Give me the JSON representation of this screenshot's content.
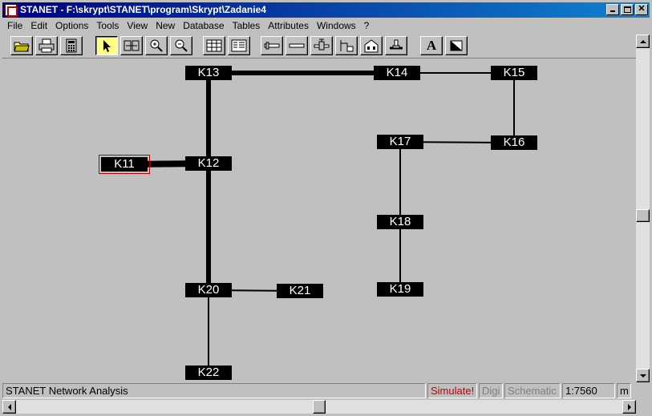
{
  "window": {
    "title": "STANET - F:\\skrypt\\STANET\\program\\Skrypt\\Zadanie4",
    "controls": [
      "minimize",
      "maximize",
      "close"
    ]
  },
  "menu": [
    "File",
    "Edit",
    "Options",
    "Tools",
    "View",
    "New",
    "Database",
    "Tables",
    "Attributes",
    "Windows",
    "?"
  ],
  "toolbar": {
    "text_tool_label": "A",
    "icons": [
      "open-folder-icon",
      "print-icon",
      "calculator-icon",
      "pointer-icon",
      "node-edit-icon",
      "zoom-in-icon",
      "zoom-out-icon",
      "table-icon",
      "form-icon",
      "pipe-icon",
      "pipe-straight-icon",
      "valve-icon",
      "pump-icon",
      "building-icon",
      "hydrant-icon",
      "text-icon",
      "fill-icon"
    ],
    "active": "pointer-icon"
  },
  "network": {
    "nodes": [
      "K11",
      "K12",
      "K13",
      "K14",
      "K15",
      "K16",
      "K17",
      "K18",
      "K19",
      "K20",
      "K21",
      "K22"
    ],
    "selected": "K11",
    "edges": [
      [
        "K13",
        "K14"
      ],
      [
        "K14",
        "K15"
      ],
      [
        "K15",
        "K16"
      ],
      [
        "K16",
        "K17"
      ],
      [
        "K17",
        "K18"
      ],
      [
        "K18",
        "K19"
      ],
      [
        "K13",
        "K12"
      ],
      [
        "K11",
        "K12"
      ],
      [
        "K12",
        "K20"
      ],
      [
        "K20",
        "K21"
      ],
      [
        "K20",
        "K22"
      ]
    ]
  },
  "status": {
    "app": "STANET Network Analysis",
    "simulate": "Simulate!",
    "digi": "Digi",
    "schematic": "Schematic",
    "scale": "1:7560",
    "unit": "m",
    "simulate_color": "#c00000",
    "disabled_color": "#808080"
  }
}
